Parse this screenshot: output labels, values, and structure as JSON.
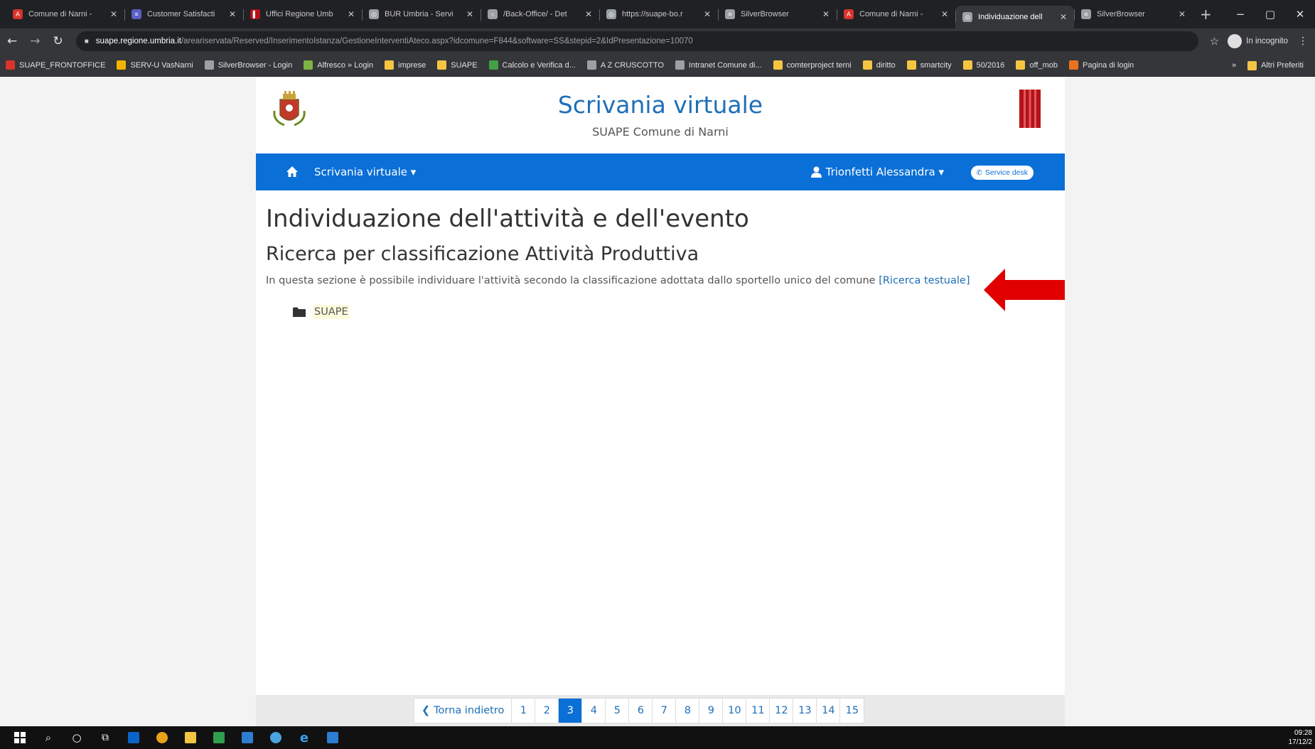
{
  "browser": {
    "tabs": [
      {
        "title": "Comune di Narni -",
        "favicon_color": "#d9342b",
        "favicon_glyph": "A"
      },
      {
        "title": "Customer Satisfacti",
        "favicon_color": "#5b5fc7",
        "favicon_glyph": "≡"
      },
      {
        "title": "Uffici Regione Umb",
        "favicon_color": "#b5121b",
        "favicon_glyph": "▌"
      },
      {
        "title": "BUR Umbria - Servi",
        "favicon_color": "#9aa0a6",
        "favicon_glyph": "◎"
      },
      {
        "title": "/Back-Office/ - Det",
        "favicon_color": "#9aa0a6",
        "favicon_glyph": "○"
      },
      {
        "title": "https://suape-bo.r",
        "favicon_color": "#9aa0a6",
        "favicon_glyph": "◎"
      },
      {
        "title": "SilverBrowser",
        "favicon_color": "#9aa0a6",
        "favicon_glyph": "≡"
      },
      {
        "title": "Comune di Narni -",
        "favicon_color": "#d9342b",
        "favicon_glyph": "A"
      },
      {
        "title": "Individuazione dell",
        "favicon_color": "#9aa0a6",
        "favicon_glyph": "◎",
        "active": true
      },
      {
        "title": "SilverBrowser",
        "favicon_color": "#9aa0a6",
        "favicon_glyph": "≡"
      }
    ],
    "url_host": "suape.regione.umbria.it",
    "url_path": "/areariservata/Reserved/InserimentoIstanza/GestioneInterventiAteco.aspx?idcomune=F844&software=SS&stepid=2&IdPresentazione=10070",
    "incognito_label": "In incognito",
    "bookmarks": [
      {
        "label": "SUAPE_FRONTOFFICE",
        "color": "#d9342b"
      },
      {
        "label": "SERV-U VasNarni",
        "color": "#f0b400"
      },
      {
        "label": "SilverBrowser - Login",
        "color": "#9aa0a6"
      },
      {
        "label": "Alfresco » Login",
        "color": "#7cb342"
      },
      {
        "label": "imprese",
        "color": "#f4c542"
      },
      {
        "label": "SUAPE",
        "color": "#f4c542"
      },
      {
        "label": "Calcolo e Verifica d...",
        "color": "#43a047"
      },
      {
        "label": "A Z CRUSCOTTO",
        "color": "#9aa0a6"
      },
      {
        "label": "Intranet Comune di...",
        "color": "#9aa0a6"
      },
      {
        "label": "comterproject terni",
        "color": "#f4c542"
      },
      {
        "label": "diritto",
        "color": "#f4c542"
      },
      {
        "label": "smartcity",
        "color": "#f4c542"
      },
      {
        "label": "50/2016",
        "color": "#f4c542"
      },
      {
        "label": "off_mob",
        "color": "#f4c542"
      },
      {
        "label": "Pagina di login",
        "color": "#e8731f"
      }
    ],
    "bookmarks_more": "»",
    "other_bookmarks": "Altri Preferiti"
  },
  "header": {
    "title": "Scrivania virtuale",
    "subtitle": "SUAPE Comune di Narni"
  },
  "navbar": {
    "menu_label": "Scrivania virtuale ▾",
    "user_label": "Trionfetti Alessandra ▾",
    "service_desk_label": "Service desk"
  },
  "content": {
    "page_title": "Individuazione dell'attività e dell'evento",
    "section_title": "Ricerca per classificazione Attività Produttiva",
    "intro_text": "In questa sezione è possibile individuare l'attività secondo la classificazione adottata dallo sportello unico del comune ",
    "intro_link": "[Ricerca testuale]",
    "tree_root": "SUAPE"
  },
  "pagination": {
    "back_label": "Torna indietro",
    "pages": [
      "1",
      "2",
      "3",
      "4",
      "5",
      "6",
      "7",
      "8",
      "9",
      "10",
      "11",
      "12",
      "13",
      "14",
      "15"
    ],
    "current_page": "3"
  },
  "colors": {
    "brand_blue": "#0a6fd6",
    "title_blue": "#1e6fb8",
    "arrow_red": "#e00000"
  },
  "taskbar": {
    "time": "09:28",
    "date": "17/12/2"
  }
}
